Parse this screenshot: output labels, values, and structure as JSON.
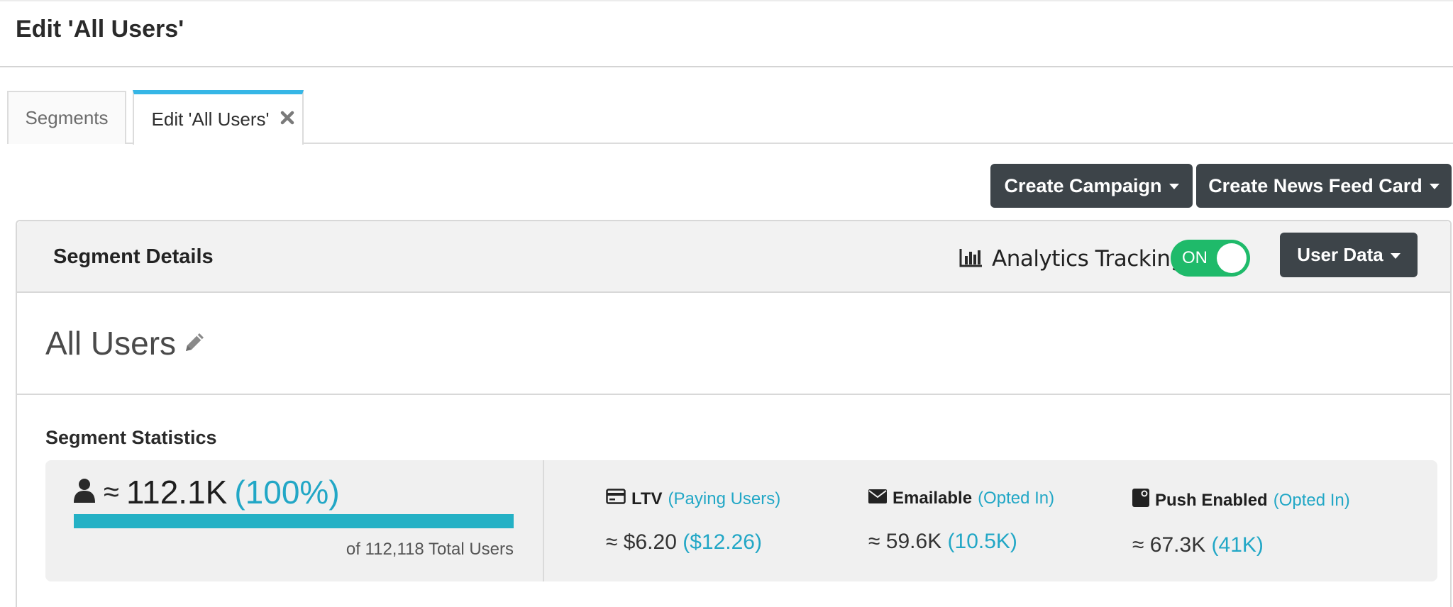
{
  "page": {
    "title": "Edit 'All Users'"
  },
  "tabs": [
    {
      "label": "Segments",
      "active": false
    },
    {
      "label": "Edit 'All Users'",
      "active": true
    }
  ],
  "toolbar": {
    "create_campaign": "Create Campaign",
    "create_news_feed_card": "Create News Feed Card"
  },
  "segment_details": {
    "title": "Segment Details",
    "analytics_tracking_label": "Analytics Tracking",
    "toggle_state": "ON",
    "user_data_button": "User Data",
    "segment_name": "All Users"
  },
  "stats": {
    "title": "Segment Statistics",
    "approx_symbol": "≈",
    "users_count": "112.1K",
    "users_percent": "(100%)",
    "users_fraction": 1.0,
    "total_users": "of 112,118 Total Users",
    "ltv": {
      "label": "LTV",
      "sub": "(Paying Users)",
      "value": "≈ $6.20",
      "sub_value": "($12.26)"
    },
    "emailable": {
      "label": "Emailable",
      "sub": "(Opted In)",
      "value": "≈ 59.6K",
      "sub_value": "(10.5K)"
    },
    "push": {
      "label": "Push Enabled",
      "sub": "(Opted In)",
      "value": "≈ 67.3K",
      "sub_value": "(41K)"
    }
  },
  "colors": {
    "accent": "#22a7c6",
    "tab_active_border": "#36b6e6",
    "toggle_on": "#1fba6a",
    "dark_button": "#3d4449",
    "progress_fill": "#24b1c5"
  },
  "icons": [
    "close-icon",
    "caret-down-icon",
    "bar-chart-icon",
    "pencil-icon",
    "user-icon",
    "credit-card-icon",
    "envelope-icon",
    "push-notification-icon"
  ]
}
